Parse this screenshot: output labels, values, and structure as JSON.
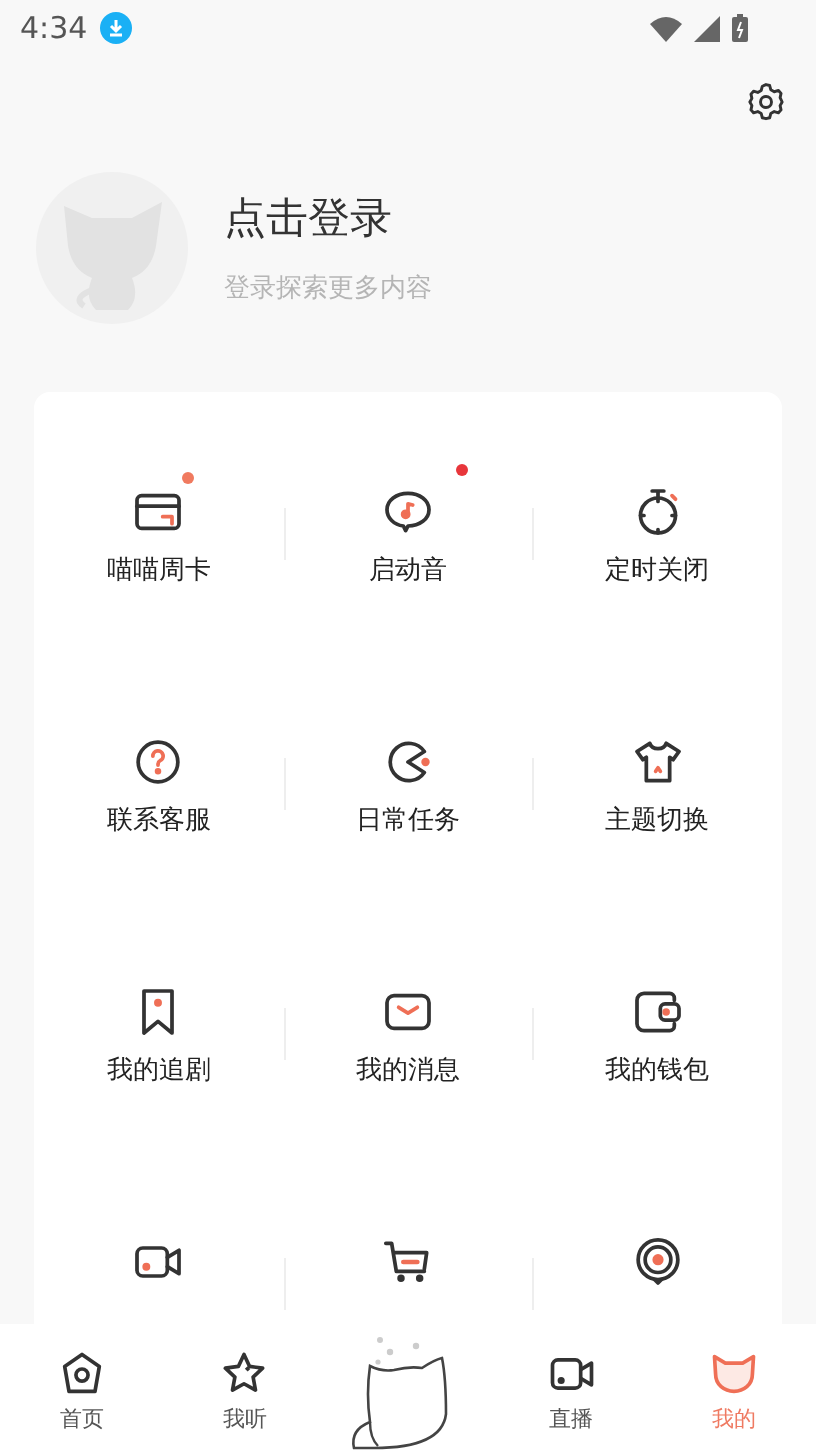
{
  "status_bar": {
    "time": "4:34"
  },
  "profile": {
    "title": "点击登录",
    "subtitle": "登录探索更多内容"
  },
  "menu": [
    {
      "kind": "tile",
      "label": "喵喵周卡",
      "color": "#f07a5f"
    },
    {
      "kind": "tile",
      "label": "启动音",
      "color": "#e8363b"
    },
    {
      "kind": "tile",
      "label": "定时关闭"
    },
    {
      "kind": "tile",
      "label": "联系客服"
    },
    {
      "kind": "tile",
      "label": "日常任务"
    },
    {
      "kind": "tile",
      "label": "主题切换"
    },
    {
      "kind": "tile",
      "label": "我的追剧"
    },
    {
      "kind": "tile",
      "label": "我的消息"
    },
    {
      "kind": "tile",
      "label": "我的钱包"
    },
    {
      "kind": "icon"
    },
    {
      "kind": "icon"
    },
    {
      "kind": "icon"
    }
  ],
  "tab_bar": [
    {
      "label": "首页",
      "selected": false
    },
    {
      "label": "我听",
      "selected": false
    },
    {
      "kind": "center"
    },
    {
      "label": "直播",
      "selected": false
    },
    {
      "label": "我的",
      "selected": true
    }
  ]
}
